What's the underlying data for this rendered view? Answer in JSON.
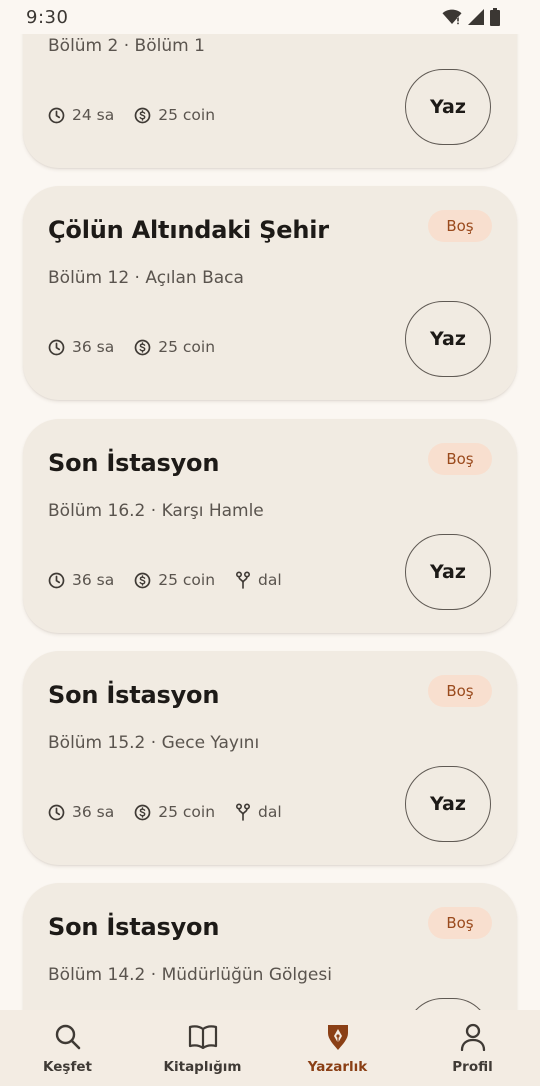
{
  "status_bar": {
    "time": "9:30"
  },
  "cards": [
    {
      "title": "",
      "badge": "",
      "subtitle": "Bölüm 2 · Bölüm 1",
      "time": "24 sa",
      "coin": "25 coin",
      "branch": "",
      "write_label": "Yaz"
    },
    {
      "title": "Çölün Altındaki Şehir",
      "badge": "Boş",
      "subtitle": "Bölüm 12 · Açılan Baca",
      "time": "36 sa",
      "coin": "25 coin",
      "branch": "",
      "write_label": "Yaz"
    },
    {
      "title": "Son İstasyon",
      "badge": "Boş",
      "subtitle": "Bölüm 16.2 · Karşı Hamle",
      "time": "36 sa",
      "coin": "25 coin",
      "branch": "dal",
      "write_label": "Yaz"
    },
    {
      "title": "Son İstasyon",
      "badge": "Boş",
      "subtitle": "Bölüm 15.2 · Gece Yayını",
      "time": "36 sa",
      "coin": "25 coin",
      "branch": "dal",
      "write_label": "Yaz"
    },
    {
      "title": "Son İstasyon",
      "badge": "Boş",
      "subtitle": "Bölüm 14.2 · Müdürlüğün Gölgesi",
      "time": "",
      "coin": "",
      "branch": "",
      "write_label": ""
    }
  ],
  "nav": {
    "items": [
      {
        "label": "Keşfet",
        "icon": "search-icon"
      },
      {
        "label": "Kitaplığım",
        "icon": "book-icon"
      },
      {
        "label": "Yazarlık",
        "icon": "pen-nib-icon"
      },
      {
        "label": "Profil",
        "icon": "person-icon"
      }
    ],
    "active_index": 2
  },
  "colors": {
    "background": "#fbf7f2",
    "card": "#f1ebe2",
    "badge_bg": "#f8dfcf",
    "badge_text": "#9a4a1d",
    "accent": "#8a3f15"
  }
}
